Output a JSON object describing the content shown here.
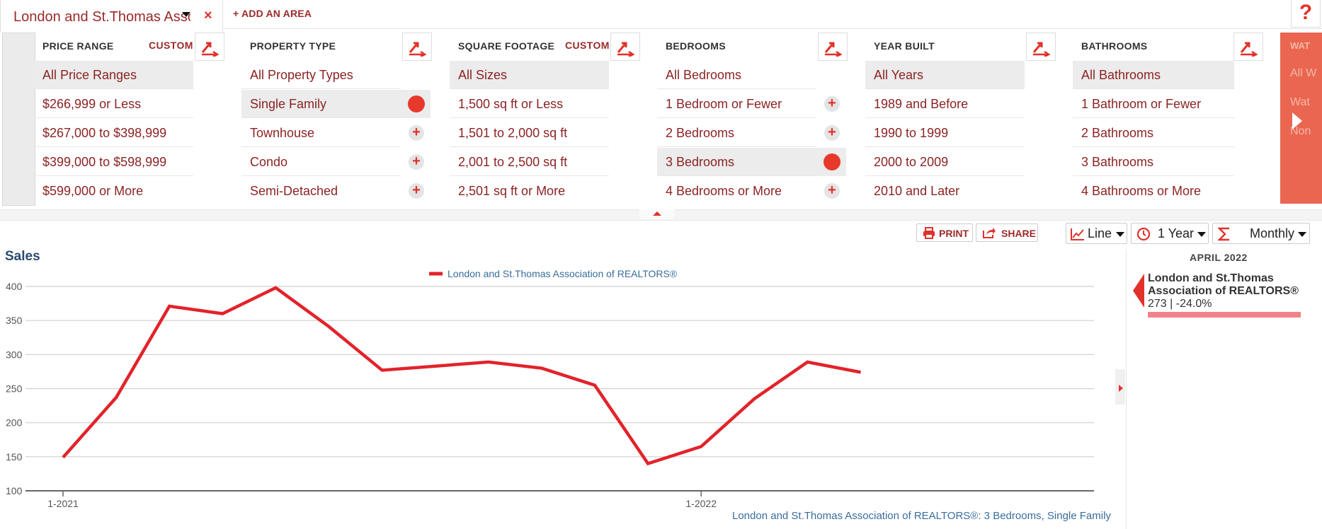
{
  "topbar": {
    "area_name": "London and St.Thomas Association of REALTORS®",
    "close_label": "×",
    "add_area_label": "+ ADD AN AREA",
    "help_label": "?"
  },
  "filters": {
    "price": {
      "title": "PRICE RANGE",
      "custom": "CUSTOM",
      "options": [
        "All Price Ranges",
        "$266,999 or Less",
        "$267,000 to $398,999",
        "$399,000 to $598,999",
        "$599,000 or More"
      ],
      "selected_index": 0
    },
    "property": {
      "title": "PROPERTY TYPE",
      "options": [
        "All Property Types",
        "Single Family",
        "Townhouse",
        "Condo",
        "Semi-Detached"
      ],
      "selected_index": 1
    },
    "sqft": {
      "title": "SQUARE FOOTAGE",
      "custom": "CUSTOM",
      "options": [
        "All Sizes",
        "1,500 sq ft or Less",
        "1,501 to 2,000 sq ft",
        "2,001 to 2,500 sq ft",
        "2,501 sq ft or More"
      ],
      "selected_index": 0
    },
    "bedrooms": {
      "title": "BEDROOMS",
      "options": [
        "All Bedrooms",
        "1 Bedroom or Fewer",
        "2 Bedrooms",
        "3 Bedrooms",
        "4 Bedrooms or More"
      ],
      "selected_index": 3
    },
    "year": {
      "title": "YEAR BUILT",
      "options": [
        "All Years",
        "1989 and Before",
        "1990 to 1999",
        "2000 to 2009",
        "2010 and Later"
      ],
      "selected_index": 0
    },
    "bathrooms": {
      "title": "BATHROOMS",
      "options": [
        "All Bathrooms",
        "1 Bathroom or Fewer",
        "2 Bathrooms",
        "3 Bathrooms",
        "4 Bathrooms or More"
      ],
      "selected_index": 0
    },
    "next_panel": {
      "title": "WAT",
      "options": [
        "All W",
        "Wat",
        "Non"
      ]
    },
    "plus_symbol": "+"
  },
  "toolbar": {
    "print_label": "PRINT",
    "share_label": "SHARE",
    "chart_type": "Line",
    "period": "1 Year",
    "interval": "Monthly"
  },
  "chart": {
    "title": "Sales",
    "note": "London and St.Thomas Association of REALTORS®: 3 Bedrooms, Single Family"
  },
  "chart_data": {
    "type": "line",
    "title": "Sales",
    "x": [
      "2021-01",
      "2021-02",
      "2021-03",
      "2021-04",
      "2021-05",
      "2021-06",
      "2021-07",
      "2021-08",
      "2021-09",
      "2021-10",
      "2021-11",
      "2021-12",
      "2022-01",
      "2022-02",
      "2022-03",
      "2022-04"
    ],
    "x_tick_labels": [
      "1-2021",
      "1-2022"
    ],
    "series": [
      {
        "name": "London and St.Thomas Association of REALTORS®",
        "color": "#e2232a",
        "values": [
          149,
          237,
          371,
          360,
          398,
          341,
          277,
          283,
          289,
          280,
          255,
          140,
          165,
          235,
          289,
          274
        ]
      }
    ],
    "y_ticks": [
      100,
      150,
      200,
      250,
      300,
      350,
      400
    ],
    "ylim": [
      100,
      400
    ],
    "grid": true,
    "legend": "top-center"
  },
  "info": {
    "month": "APRIL 2022",
    "name": "London and St.Thomas Association of REALTORS®",
    "value": "273 | -24.0%"
  },
  "colors": {
    "accent": "#e2312a",
    "label_text": "#8c2323",
    "chart_line": "#e2232a",
    "title_blue": "#2b4a73"
  }
}
